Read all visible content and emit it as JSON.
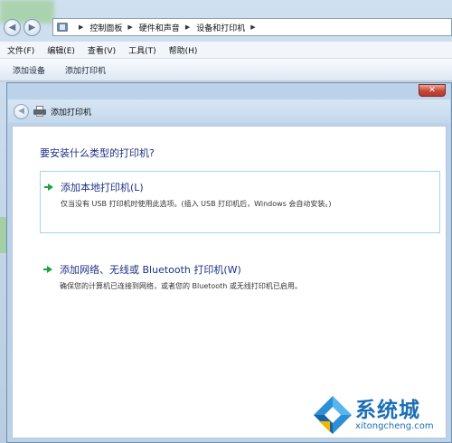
{
  "background_window": {
    "breadcrumb": [
      "控制面板",
      "硬件和声音",
      "设备和打印机"
    ],
    "menu": [
      "文件(F)",
      "编辑(E)",
      "查看(V)",
      "工具(T)",
      "帮助(H)"
    ],
    "commands": [
      "添加设备",
      "添加打印机"
    ]
  },
  "dialog": {
    "close_label": "✕",
    "title": "添加打印机",
    "question": "要安装什么类型的打印机?",
    "options": [
      {
        "title": "添加本地打印机(L)",
        "description": "仅当没有 USB 打印机时使用此选项。(插入 USB 打印机后，Windows 会自动安装。)"
      },
      {
        "title": "添加网络、无线或 Bluetooth 打印机(W)",
        "description": "确保您的计算机已连接到网络，或者您的 Bluetooth 或无线打印机已启用。"
      }
    ]
  },
  "watermark": {
    "brand": "系统城",
    "url": "xitongcheng.com"
  },
  "colors": {
    "link_blue": "#1e3287",
    "arrow_green": "#1aa33c",
    "selection_border": "#9fd8ef",
    "watermark_blue": "#1b6fb7"
  }
}
